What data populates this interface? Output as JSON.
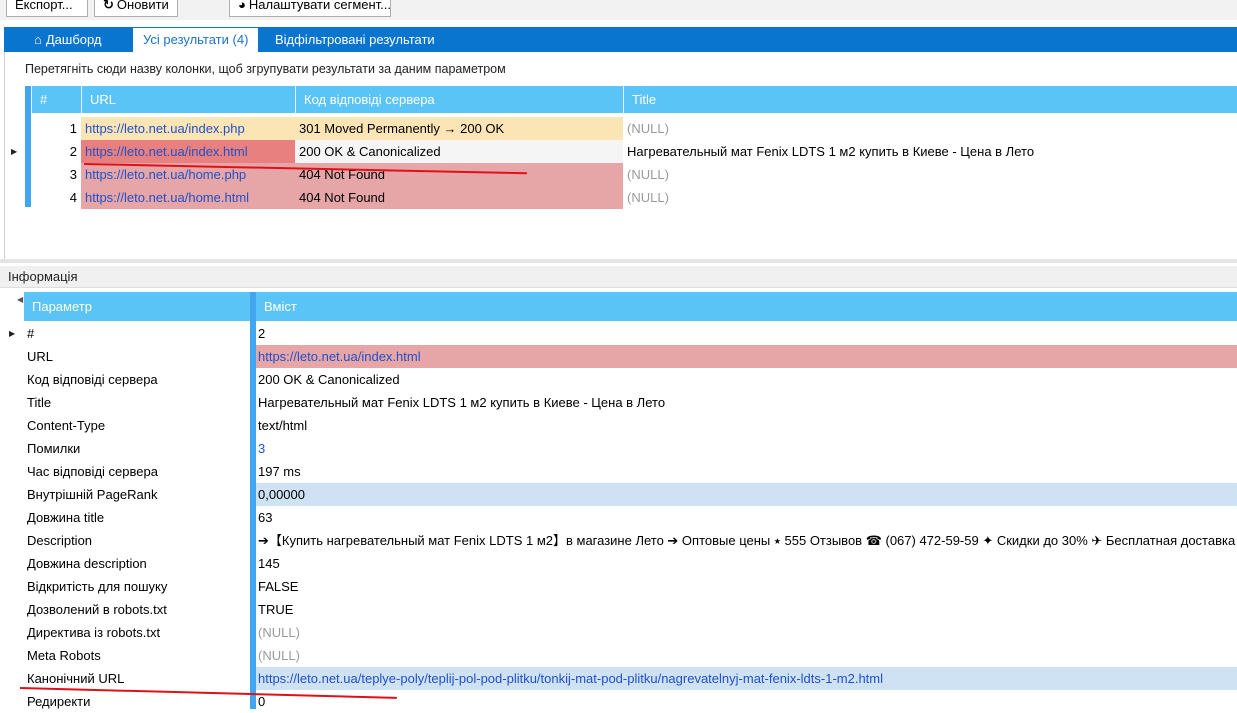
{
  "toolbar": {
    "export_label": "Експорт...",
    "refresh_label": "Оновити",
    "segments_label": "Налаштувати сегмент..."
  },
  "tabs": [
    {
      "label": "Дашборд",
      "active": false
    },
    {
      "label": "Усі результати (4)",
      "active": true
    },
    {
      "label": "Відфільтровані результати",
      "active": false
    }
  ],
  "results": {
    "group_hint": "Перетягніть сюди назву колонки, щоб згрупувати результати за даним параметром",
    "columns": [
      "#",
      "URL",
      "Код відповіді сервера",
      "Title"
    ],
    "rows": [
      {
        "num": "1",
        "url": "https://leto.net.ua/index.php",
        "status": "301 Moved Permanently → 200 OK",
        "title": "(NULL)",
        "status_color": "#fce5b4",
        "url_color": "#fce5b4",
        "selected": false
      },
      {
        "num": "2",
        "url": "https://leto.net.ua/index.html",
        "status": "200 OK & Canonicalized",
        "title": "Нагревательный мат Fenix LDTS 1 м2 купить в Киеве - Цена в Лето",
        "status_color": "#f5f5f5",
        "url_color": "#e88080",
        "selected": true
      },
      {
        "num": "3",
        "url": "https://leto.net.ua/home.php",
        "status": "404 Not Found",
        "title": "(NULL)",
        "status_color": "#e6a6a8",
        "url_color": "#e6a6a8",
        "selected": false
      },
      {
        "num": "4",
        "url": "https://leto.net.ua/home.html",
        "status": "404 Not Found",
        "title": "(NULL)",
        "status_color": "#e6a6a8",
        "url_color": "#e6a6a8",
        "selected": false
      }
    ]
  },
  "info": {
    "title": "Інформація",
    "columns": [
      "Параметр",
      "Вміст"
    ],
    "rows": [
      {
        "param": "#",
        "value": "2",
        "type": "text",
        "bg": ""
      },
      {
        "param": "URL",
        "value": "https://leto.net.ua/index.html",
        "type": "link",
        "bg": "#e6a6a8"
      },
      {
        "param": "Код відповіді сервера",
        "value": "200 OK & Canonicalized",
        "type": "text",
        "bg": ""
      },
      {
        "param": "Title",
        "value": "Нагревательный мат Fenix LDTS 1 м2 купить в Киеве - Цена в Лето",
        "type": "text",
        "bg": ""
      },
      {
        "param": "Content-Type",
        "value": "text/html",
        "type": "text",
        "bg": ""
      },
      {
        "param": "Помилки",
        "value": "3",
        "type": "link",
        "bg": ""
      },
      {
        "param": "Час відповіді сервера",
        "value": "197 ms",
        "type": "text",
        "bg": ""
      },
      {
        "param": "Внутрішній PageRank",
        "value": "0,00000",
        "type": "text",
        "bg": "#cfe2f3"
      },
      {
        "param": "Довжина title",
        "value": "63",
        "type": "text",
        "bg": ""
      },
      {
        "param": "Description",
        "value": "➔【Купить нагревательный мат Fenix LDTS 1 м2】в магазине Лето ➔ Оптовые цены ⭑ 555 Отзывов ☎ (067) 472-59-59 ✦ Скидки до 30% ✈ Бесплатная доставка",
        "type": "text",
        "bg": ""
      },
      {
        "param": "Довжина description",
        "value": "145",
        "type": "text",
        "bg": ""
      },
      {
        "param": "Відкритість для пошуку",
        "value": "FALSE",
        "type": "text",
        "bg": ""
      },
      {
        "param": "Дозволений в robots.txt",
        "value": "TRUE",
        "type": "text",
        "bg": ""
      },
      {
        "param": "Директива із robots.txt",
        "value": "(NULL)",
        "type": "null",
        "bg": ""
      },
      {
        "param": "Meta Robots",
        "value": "(NULL)",
        "type": "null",
        "bg": ""
      },
      {
        "param": "Канонічний URL",
        "value": "https://leto.net.ua/teplye-poly/teplij-pol-pod-plitku/tonkij-mat-pod-plitku/nagrevatelnyj-mat-fenix-ldts-1-m2.html",
        "type": "link",
        "bg": "#cfe2f3"
      },
      {
        "param": "Редиректи",
        "value": "0",
        "type": "text",
        "bg": ""
      }
    ]
  },
  "colors": {
    "accent": "#0a75cf",
    "grid_header": "#5bc4f7",
    "link": "#2150c8",
    "annotation": "#e0101a"
  }
}
